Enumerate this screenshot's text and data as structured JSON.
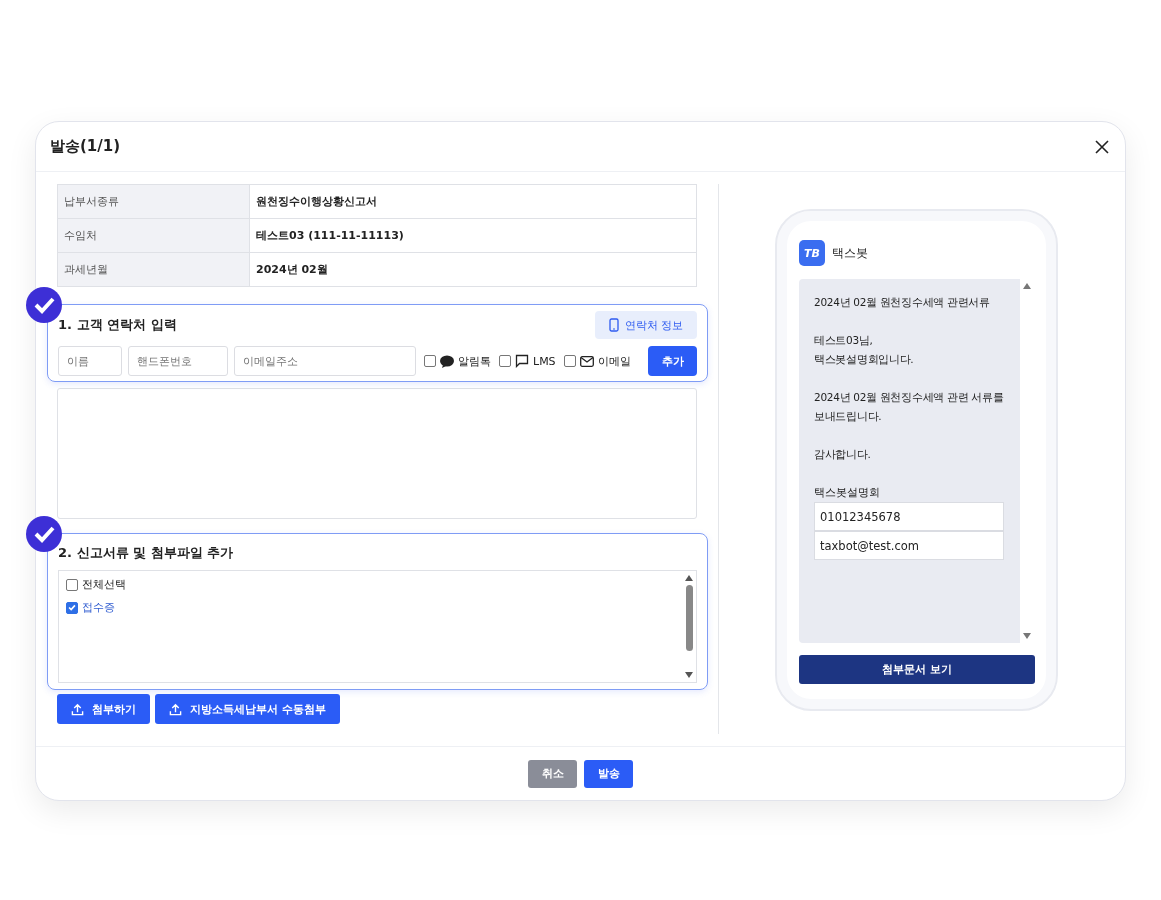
{
  "dialog": {
    "title": "발송(1/1)"
  },
  "info_table": [
    {
      "label": "납부서종류",
      "value": "원천징수이행상황신고서"
    },
    {
      "label": "수임처",
      "value": "테스트03 (111-11-11113)"
    },
    {
      "label": "과세년월",
      "value": "2024년 02월"
    }
  ],
  "contact_section": {
    "title": "1. 고객 연락처 입력",
    "done": true,
    "info_button": "연락처 정보",
    "fields": [
      {
        "placeholder": "이름"
      },
      {
        "placeholder": "핸드폰번호"
      },
      {
        "placeholder": "이메일주소"
      }
    ],
    "channels": [
      {
        "kind": "chat",
        "label": "알림톡",
        "checked": false
      },
      {
        "kind": "message",
        "label": "LMS",
        "checked": false
      },
      {
        "kind": "mail",
        "label": "이메일",
        "checked": false
      }
    ],
    "add_button": "추가"
  },
  "docs_section": {
    "title": "2. 신고서류 및 첨부파일 추가",
    "done": true,
    "items": [
      {
        "label": "전체선택",
        "checked": false
      },
      {
        "label": "접수증",
        "checked": true
      }
    ]
  },
  "attach_buttons": [
    "첨부하기",
    "지방소득세납부서 수동첨부"
  ],
  "preview": {
    "logo": "TB",
    "sender": "택스봇",
    "paragraphs": [
      "2024년 02월 원천징수세액 관련서류",
      "테스트03님,\n택스봇설명회입니다.",
      "2024년 02월 원천징수세액 관련 서류를 보내드립니다.",
      "감사합니다."
    ],
    "signature": "택스봇설명회",
    "contacts": [
      "01012345678",
      "taxbot@test.com"
    ],
    "view_button": "첨부문서 보기"
  },
  "footer_buttons": [
    {
      "kind": "secondary",
      "label": "취소"
    },
    {
      "kind": "primary",
      "label": "발송"
    }
  ]
}
